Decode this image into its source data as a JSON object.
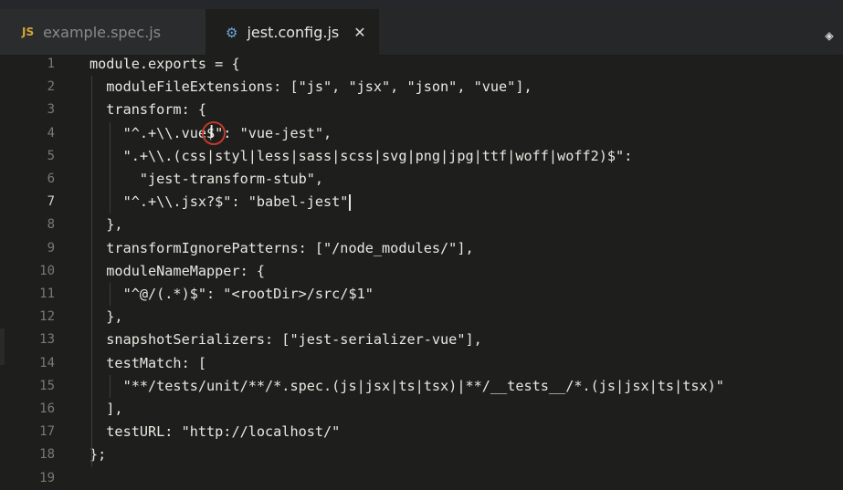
{
  "tabs": [
    {
      "icon": "JS",
      "label": "example.spec.js"
    },
    {
      "icon": "gear-icon",
      "label": "jest.config.js",
      "close": "✕"
    }
  ],
  "editor": {
    "lines": [
      {
        "n": "1",
        "text": "module.exports = {"
      },
      {
        "n": "2",
        "text": "  moduleFileExtensions: [\"js\", \"jsx\", \"json\", \"vue\"],"
      },
      {
        "n": "3",
        "text": "  transform: {"
      },
      {
        "n": "4",
        "text": "    \"^.+\\\\.vue$\": \"vue-jest\","
      },
      {
        "n": "5",
        "text": "    \".+\\\\.(css|styl|less|sass|scss|svg|png|jpg|ttf|woff|woff2)$\":"
      },
      {
        "n": "6",
        "text": "      \"jest-transform-stub\","
      },
      {
        "n": "7",
        "text": "    \"^.+\\\\.jsx?$\": \"babel-jest\""
      },
      {
        "n": "8",
        "text": "  },"
      },
      {
        "n": "9",
        "text": "  transformIgnorePatterns: [\"/node_modules/\"],"
      },
      {
        "n": "10",
        "text": "  moduleNameMapper: {"
      },
      {
        "n": "11",
        "text": "    \"^@/(.*)$\": \"<rootDir>/src/$1\""
      },
      {
        "n": "12",
        "text": "  },"
      },
      {
        "n": "13",
        "text": "  snapshotSerializers: [\"jest-serializer-vue\"],"
      },
      {
        "n": "14",
        "text": "  testMatch: ["
      },
      {
        "n": "15",
        "text": "    \"**/tests/unit/**/*.spec.(js|jsx|ts|tsx)|**/__tests__/*.(js|jsx|ts|tsx)\""
      },
      {
        "n": "16",
        "text": "  ],"
      },
      {
        "n": "17",
        "text": "  testURL: \"http://localhost/\""
      },
      {
        "n": "18",
        "text": "};"
      },
      {
        "n": "19",
        "text": ""
      }
    ],
    "active_line": "7"
  },
  "colors": {
    "background": "#1e1f1c",
    "tab_inactive": "#2b2c2e",
    "line_number": "#7a7a74",
    "code_text": "#e8e8e2",
    "js_badge": "#d5a53a",
    "gear": "#6ea7d8",
    "mouse_ring": "#c0392b"
  }
}
